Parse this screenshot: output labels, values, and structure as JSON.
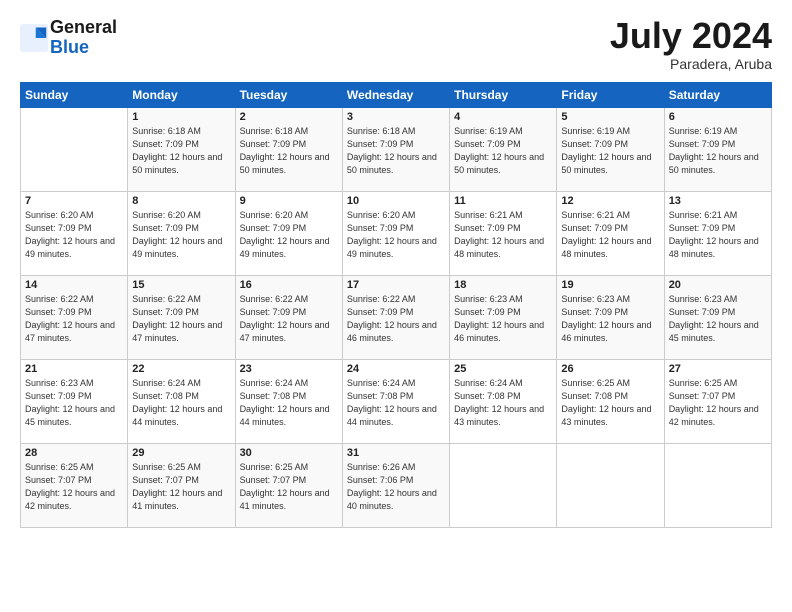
{
  "header": {
    "logo_general": "General",
    "logo_blue": "Blue",
    "month_title": "July 2024",
    "location": "Paradera, Aruba"
  },
  "days_of_week": [
    "Sunday",
    "Monday",
    "Tuesday",
    "Wednesday",
    "Thursday",
    "Friday",
    "Saturday"
  ],
  "weeks": [
    [
      {
        "day": "",
        "sunrise": "",
        "sunset": "",
        "daylight": ""
      },
      {
        "day": "1",
        "sunrise": "Sunrise: 6:18 AM",
        "sunset": "Sunset: 7:09 PM",
        "daylight": "Daylight: 12 hours and 50 minutes."
      },
      {
        "day": "2",
        "sunrise": "Sunrise: 6:18 AM",
        "sunset": "Sunset: 7:09 PM",
        "daylight": "Daylight: 12 hours and 50 minutes."
      },
      {
        "day": "3",
        "sunrise": "Sunrise: 6:18 AM",
        "sunset": "Sunset: 7:09 PM",
        "daylight": "Daylight: 12 hours and 50 minutes."
      },
      {
        "day": "4",
        "sunrise": "Sunrise: 6:19 AM",
        "sunset": "Sunset: 7:09 PM",
        "daylight": "Daylight: 12 hours and 50 minutes."
      },
      {
        "day": "5",
        "sunrise": "Sunrise: 6:19 AM",
        "sunset": "Sunset: 7:09 PM",
        "daylight": "Daylight: 12 hours and 50 minutes."
      },
      {
        "day": "6",
        "sunrise": "Sunrise: 6:19 AM",
        "sunset": "Sunset: 7:09 PM",
        "daylight": "Daylight: 12 hours and 50 minutes."
      }
    ],
    [
      {
        "day": "7",
        "sunrise": "Sunrise: 6:20 AM",
        "sunset": "Sunset: 7:09 PM",
        "daylight": "Daylight: 12 hours and 49 minutes."
      },
      {
        "day": "8",
        "sunrise": "Sunrise: 6:20 AM",
        "sunset": "Sunset: 7:09 PM",
        "daylight": "Daylight: 12 hours and 49 minutes."
      },
      {
        "day": "9",
        "sunrise": "Sunrise: 6:20 AM",
        "sunset": "Sunset: 7:09 PM",
        "daylight": "Daylight: 12 hours and 49 minutes."
      },
      {
        "day": "10",
        "sunrise": "Sunrise: 6:20 AM",
        "sunset": "Sunset: 7:09 PM",
        "daylight": "Daylight: 12 hours and 49 minutes."
      },
      {
        "day": "11",
        "sunrise": "Sunrise: 6:21 AM",
        "sunset": "Sunset: 7:09 PM",
        "daylight": "Daylight: 12 hours and 48 minutes."
      },
      {
        "day": "12",
        "sunrise": "Sunrise: 6:21 AM",
        "sunset": "Sunset: 7:09 PM",
        "daylight": "Daylight: 12 hours and 48 minutes."
      },
      {
        "day": "13",
        "sunrise": "Sunrise: 6:21 AM",
        "sunset": "Sunset: 7:09 PM",
        "daylight": "Daylight: 12 hours and 48 minutes."
      }
    ],
    [
      {
        "day": "14",
        "sunrise": "Sunrise: 6:22 AM",
        "sunset": "Sunset: 7:09 PM",
        "daylight": "Daylight: 12 hours and 47 minutes."
      },
      {
        "day": "15",
        "sunrise": "Sunrise: 6:22 AM",
        "sunset": "Sunset: 7:09 PM",
        "daylight": "Daylight: 12 hours and 47 minutes."
      },
      {
        "day": "16",
        "sunrise": "Sunrise: 6:22 AM",
        "sunset": "Sunset: 7:09 PM",
        "daylight": "Daylight: 12 hours and 47 minutes."
      },
      {
        "day": "17",
        "sunrise": "Sunrise: 6:22 AM",
        "sunset": "Sunset: 7:09 PM",
        "daylight": "Daylight: 12 hours and 46 minutes."
      },
      {
        "day": "18",
        "sunrise": "Sunrise: 6:23 AM",
        "sunset": "Sunset: 7:09 PM",
        "daylight": "Daylight: 12 hours and 46 minutes."
      },
      {
        "day": "19",
        "sunrise": "Sunrise: 6:23 AM",
        "sunset": "Sunset: 7:09 PM",
        "daylight": "Daylight: 12 hours and 46 minutes."
      },
      {
        "day": "20",
        "sunrise": "Sunrise: 6:23 AM",
        "sunset": "Sunset: 7:09 PM",
        "daylight": "Daylight: 12 hours and 45 minutes."
      }
    ],
    [
      {
        "day": "21",
        "sunrise": "Sunrise: 6:23 AM",
        "sunset": "Sunset: 7:09 PM",
        "daylight": "Daylight: 12 hours and 45 minutes."
      },
      {
        "day": "22",
        "sunrise": "Sunrise: 6:24 AM",
        "sunset": "Sunset: 7:08 PM",
        "daylight": "Daylight: 12 hours and 44 minutes."
      },
      {
        "day": "23",
        "sunrise": "Sunrise: 6:24 AM",
        "sunset": "Sunset: 7:08 PM",
        "daylight": "Daylight: 12 hours and 44 minutes."
      },
      {
        "day": "24",
        "sunrise": "Sunrise: 6:24 AM",
        "sunset": "Sunset: 7:08 PM",
        "daylight": "Daylight: 12 hours and 44 minutes."
      },
      {
        "day": "25",
        "sunrise": "Sunrise: 6:24 AM",
        "sunset": "Sunset: 7:08 PM",
        "daylight": "Daylight: 12 hours and 43 minutes."
      },
      {
        "day": "26",
        "sunrise": "Sunrise: 6:25 AM",
        "sunset": "Sunset: 7:08 PM",
        "daylight": "Daylight: 12 hours and 43 minutes."
      },
      {
        "day": "27",
        "sunrise": "Sunrise: 6:25 AM",
        "sunset": "Sunset: 7:07 PM",
        "daylight": "Daylight: 12 hours and 42 minutes."
      }
    ],
    [
      {
        "day": "28",
        "sunrise": "Sunrise: 6:25 AM",
        "sunset": "Sunset: 7:07 PM",
        "daylight": "Daylight: 12 hours and 42 minutes."
      },
      {
        "day": "29",
        "sunrise": "Sunrise: 6:25 AM",
        "sunset": "Sunset: 7:07 PM",
        "daylight": "Daylight: 12 hours and 41 minutes."
      },
      {
        "day": "30",
        "sunrise": "Sunrise: 6:25 AM",
        "sunset": "Sunset: 7:07 PM",
        "daylight": "Daylight: 12 hours and 41 minutes."
      },
      {
        "day": "31",
        "sunrise": "Sunrise: 6:26 AM",
        "sunset": "Sunset: 7:06 PM",
        "daylight": "Daylight: 12 hours and 40 minutes."
      },
      {
        "day": "",
        "sunrise": "",
        "sunset": "",
        "daylight": ""
      },
      {
        "day": "",
        "sunrise": "",
        "sunset": "",
        "daylight": ""
      },
      {
        "day": "",
        "sunrise": "",
        "sunset": "",
        "daylight": ""
      }
    ]
  ]
}
